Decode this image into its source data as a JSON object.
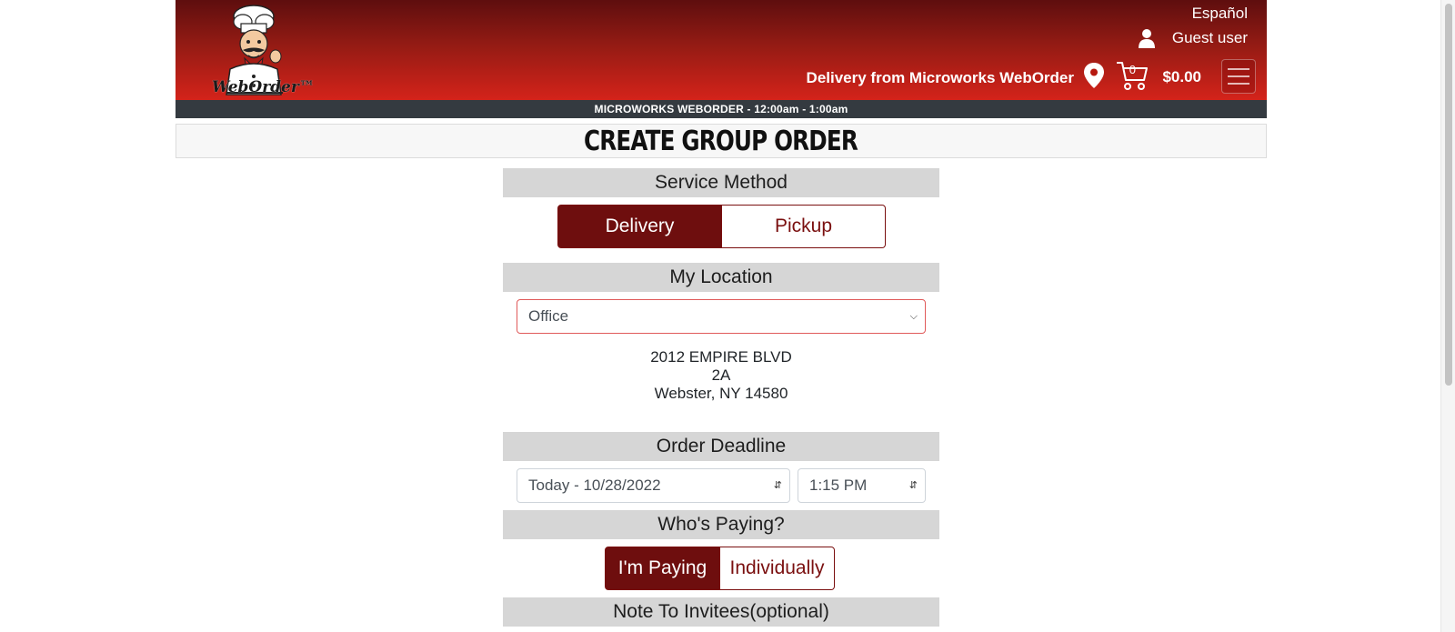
{
  "header": {
    "logo_text": "WebOrder™",
    "language_link": "Español",
    "user_label": "Guest user",
    "delivery_from": "Delivery from Microworks WebOrder",
    "cart_count": "0",
    "cart_total": "$0.00"
  },
  "banner": {
    "text": "MICROWORKS WEBORDER - 12:00am - 1:00am"
  },
  "page": {
    "title": "Create Group Order"
  },
  "service_method": {
    "heading": "Service Method",
    "options": [
      {
        "label": "Delivery",
        "selected": true
      },
      {
        "label": "Pickup",
        "selected": false
      }
    ]
  },
  "location": {
    "heading": "My Location",
    "selected": "Office",
    "address_line1": "2012 EMPIRE BLVD",
    "address_line2": "2A",
    "address_line3": "Webster, NY 14580"
  },
  "deadline": {
    "heading": "Order Deadline",
    "date_selected": "Today - 10/28/2022",
    "time_selected": "1:15 PM"
  },
  "paying": {
    "heading": "Who's Paying?",
    "options": [
      {
        "label": "I'm Paying",
        "selected": true
      },
      {
        "label": "Individually",
        "selected": false
      }
    ]
  },
  "note": {
    "heading": "Note To Invitees(optional)"
  },
  "colors": {
    "brand_dark": "#6e0e0e",
    "header_red": "#d4231a",
    "banner": "#343a40"
  }
}
